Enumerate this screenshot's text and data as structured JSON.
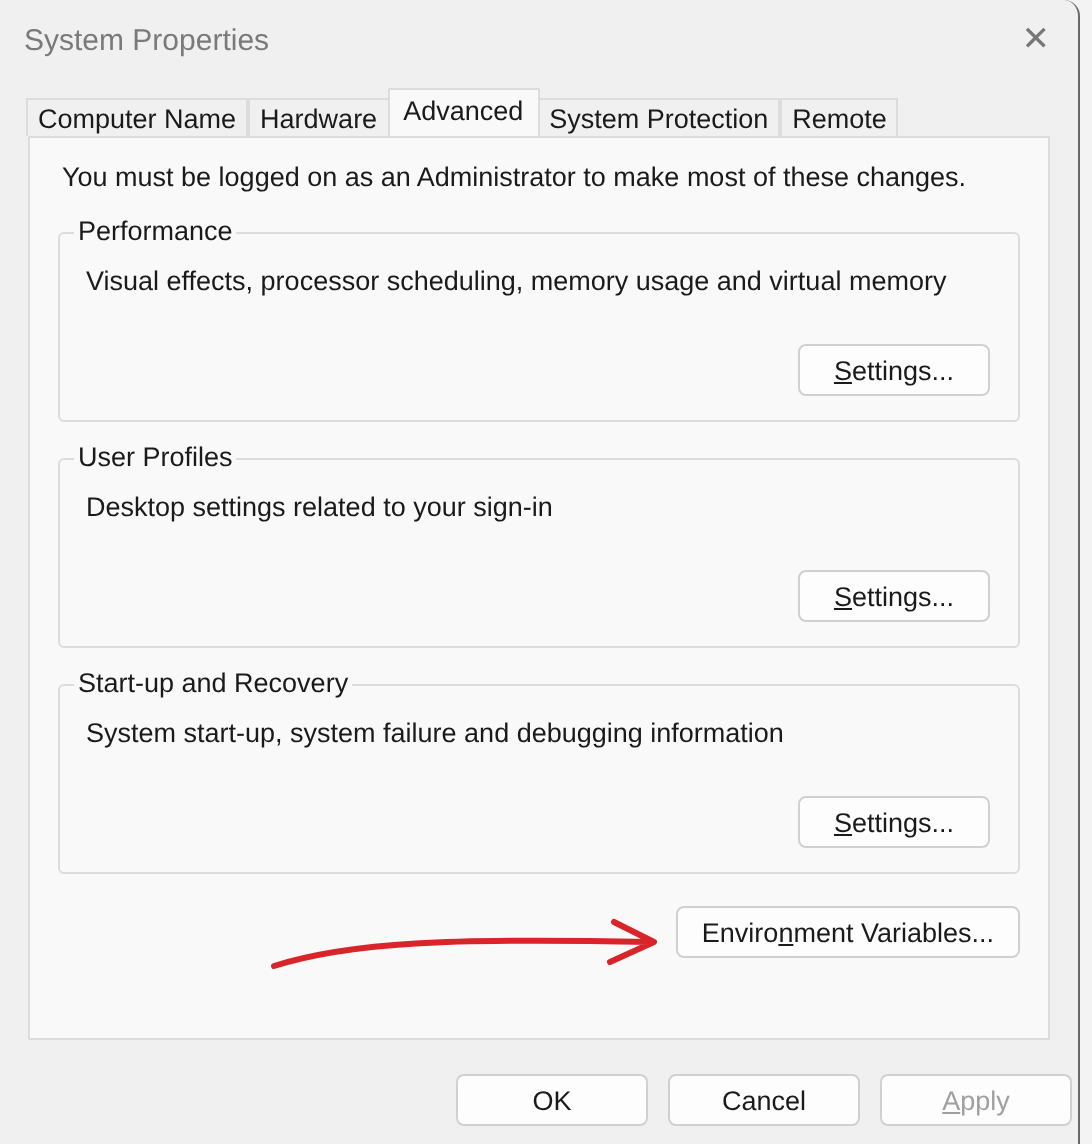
{
  "window": {
    "title": "System Properties",
    "close": "✕"
  },
  "tabs": [
    {
      "label": "Computer Name",
      "selected": false
    },
    {
      "label": "Hardware",
      "selected": false
    },
    {
      "label": "Advanced",
      "selected": true
    },
    {
      "label": "System Protection",
      "selected": false
    },
    {
      "label": "Remote",
      "selected": false
    }
  ],
  "notice": "You must be logged on as an Administrator to make most of these changes.",
  "groups": [
    {
      "title": "Performance",
      "description": "Visual effects, processor scheduling, memory usage and virtual memory",
      "button": {
        "access_key": "S",
        "label_rest": "ettings..."
      }
    },
    {
      "title": "User Profiles",
      "description": "Desktop settings related to your sign-in",
      "button": {
        "access_key": "S",
        "label_rest": "ettings..."
      }
    },
    {
      "title": "Start-up and Recovery",
      "description": "System start-up, system failure and debugging information",
      "button": {
        "access_key": "S",
        "label_rest": "ettings..."
      }
    }
  ],
  "environment_button": {
    "label_start": "Enviro",
    "access_key": "n",
    "label_rest": "ment Variables..."
  },
  "buttons": [
    {
      "label_rest": "OK",
      "disabled": false
    },
    {
      "label_rest": "Cancel",
      "disabled": false
    },
    {
      "access_key": "A",
      "label_rest": "pply",
      "disabled": true
    }
  ]
}
